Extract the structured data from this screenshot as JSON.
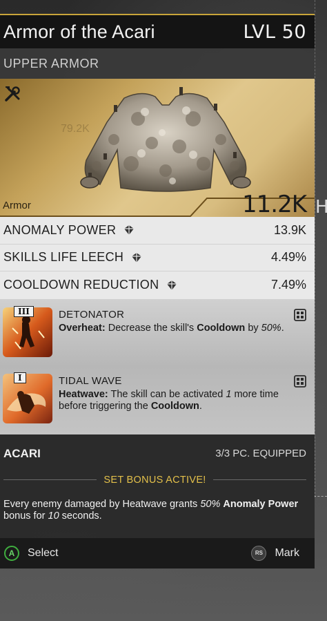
{
  "item": {
    "name": "Armor of the Acari",
    "level": "LVL 50",
    "slot": "UPPER ARMOR",
    "armor_label": "Armor",
    "armor_value": "11.2K",
    "side_letter": "H"
  },
  "hero": {
    "ghost_text": "79.2K"
  },
  "stats": [
    {
      "name": "ANOMALY POWER",
      "value": "13.9K",
      "icon": "gem-icon"
    },
    {
      "name": "SKILLS LIFE LEECH",
      "value": "4.49%",
      "icon": "gem-icon"
    },
    {
      "name": "COOLDOWN REDUCTION",
      "value": "7.49%",
      "icon": "gem-icon"
    }
  ],
  "skills": [
    {
      "rank": "III",
      "name": "DETONATOR",
      "desc_a": "Overheat:",
      "desc_b": " Decrease the skill's ",
      "desc_c": "Cooldown",
      "desc_d": " by ",
      "desc_e": "50%",
      "desc_f": "."
    },
    {
      "rank": "I",
      "name": "TIDAL WAVE",
      "desc_a": "Heatwave:",
      "desc_b": " The skill can be activated ",
      "desc_c": "1",
      "desc_d": " more time before triggering the ",
      "desc_e": "Cooldown",
      "desc_f": "."
    }
  ],
  "set": {
    "name": "ACARI",
    "count": "3/3 PC. EQUIPPED",
    "bonus_label": "SET BONUS ACTIVE!",
    "desc_1": "Every enemy damaged by Heatwave grants ",
    "desc_2": "50%",
    "desc_3": "Anomaly Power",
    "desc_4": " bonus for ",
    "desc_5": "10",
    "desc_6": " seconds."
  },
  "footer": {
    "select_btn": "A",
    "select_label": "Select",
    "mark_btn": "RS",
    "mark_label": "Mark"
  },
  "colors": {
    "accent_gold": "#c9a53a",
    "set_bonus": "#e3c04a",
    "select_green": "#3fae3f"
  }
}
